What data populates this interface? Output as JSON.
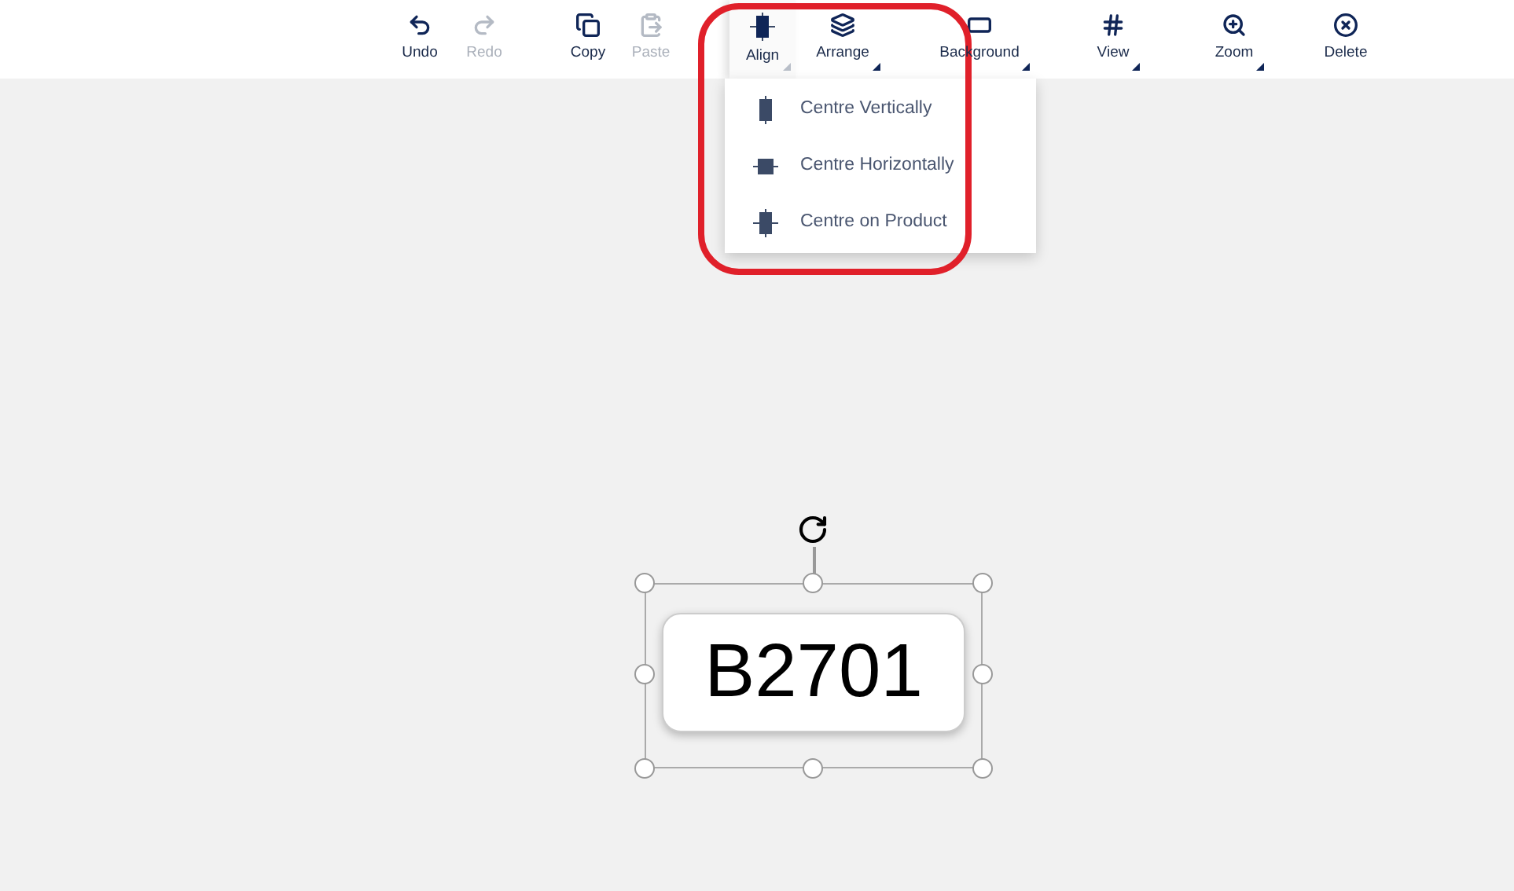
{
  "toolbar": [
    {
      "label": "Undo",
      "disabled": false,
      "dropdown": false,
      "selected": false
    },
    {
      "label": "Redo",
      "disabled": true,
      "dropdown": false,
      "selected": false
    },
    {
      "label": "Copy",
      "disabled": false,
      "dropdown": false,
      "selected": false
    },
    {
      "label": "Paste",
      "disabled": true,
      "dropdown": false,
      "selected": false
    },
    {
      "label": "Align",
      "disabled": false,
      "dropdown": true,
      "selected": true
    },
    {
      "label": "Arrange",
      "disabled": false,
      "dropdown": true,
      "selected": false
    },
    {
      "label": "Background",
      "disabled": false,
      "dropdown": true,
      "selected": false
    },
    {
      "label": "View",
      "disabled": false,
      "dropdown": true,
      "selected": false
    },
    {
      "label": "Zoom",
      "disabled": false,
      "dropdown": true,
      "selected": false
    },
    {
      "label": "Delete",
      "disabled": false,
      "dropdown": false,
      "selected": false
    }
  ],
  "align_menu": {
    "items": [
      {
        "label": "Centre Vertically",
        "kind": "vertical"
      },
      {
        "label": "Centre Horizontally",
        "kind": "horizontal"
      },
      {
        "label": "Centre on Product",
        "kind": "product"
      }
    ]
  },
  "canvas": {
    "label_text": "B2701"
  }
}
